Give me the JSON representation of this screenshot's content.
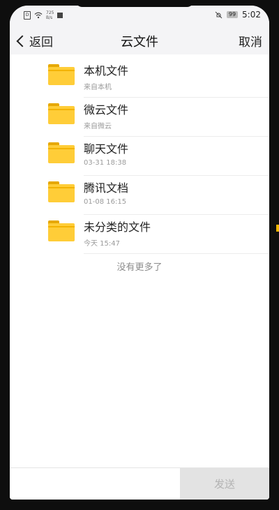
{
  "status_bar": {
    "sim_label": "D",
    "speed_value": "725",
    "speed_unit": "B/s",
    "battery": "99",
    "time": "5:02"
  },
  "nav": {
    "back_label": "返回",
    "title": "云文件",
    "cancel_label": "取消"
  },
  "folders": [
    {
      "name": "本机文件",
      "subtitle": "来自本机"
    },
    {
      "name": "微云文件",
      "subtitle": "来自微云"
    },
    {
      "name": "聊天文件",
      "subtitle": "03-31 18:38"
    },
    {
      "name": "腾讯文档",
      "subtitle": "01-08 16:15"
    },
    {
      "name": "未分类的文件",
      "subtitle": "今天 15:47"
    }
  ],
  "footer_text": "没有更多了",
  "bottom": {
    "send_label": "发送"
  },
  "colors": {
    "folder_yellow": "#ffcd38",
    "accent_yellow": "#f0b400"
  }
}
